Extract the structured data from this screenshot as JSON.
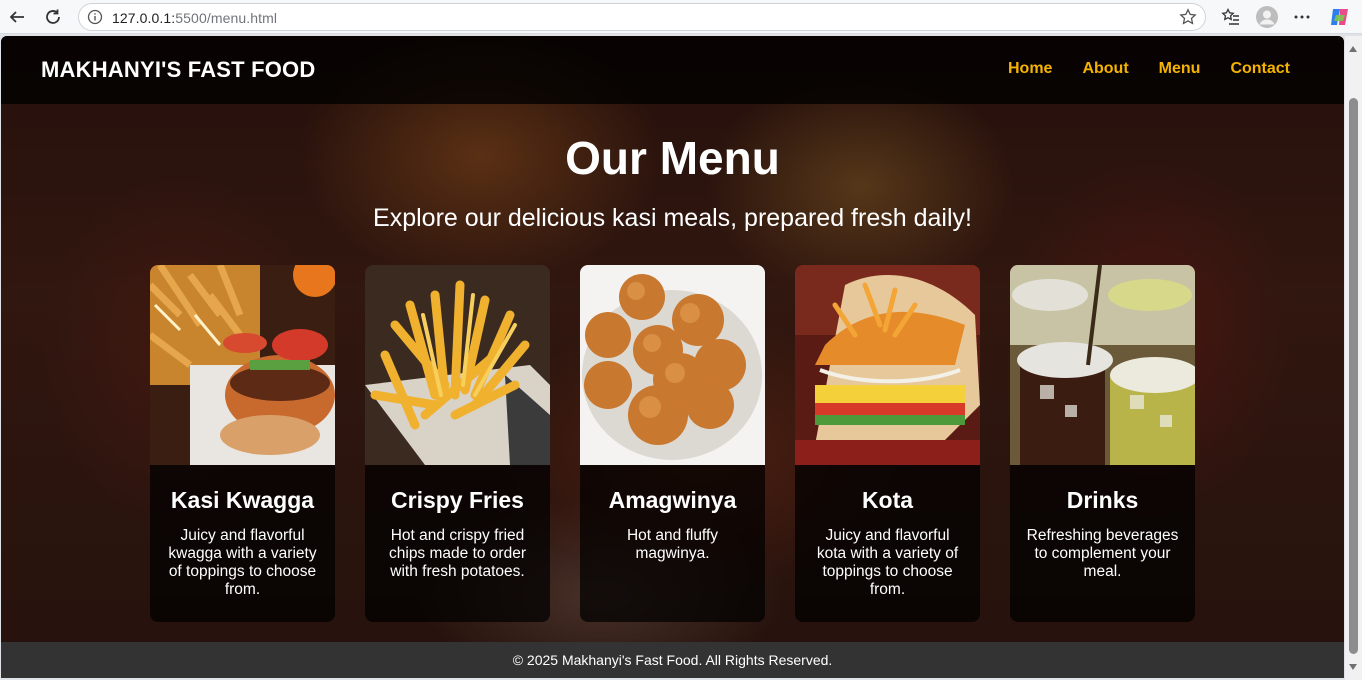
{
  "browser": {
    "url_host": "127.0.0.1:",
    "url_rest": "5500/menu.html"
  },
  "site": {
    "logo": "MAKHANYI'S FAST FOOD",
    "nav": [
      "Home",
      "About",
      "Menu",
      "Contact"
    ],
    "accent_color": "#f5b301"
  },
  "hero": {
    "title": "Our Menu",
    "subtitle": "Explore our delicious kasi meals, prepared fresh daily!"
  },
  "menu_items": [
    {
      "name": "Kasi Kwagga",
      "description": "Juicy and flavorful kwagga with a variety of toppings to choose from.",
      "image": "burger-and-chips-photo"
    },
    {
      "name": "Crispy Fries",
      "description": "Hot and crispy fried chips made to order with fresh potatoes.",
      "image": "fries-basket-photo"
    },
    {
      "name": "Amagwinya",
      "description": "Hot and fluffy magwinya.",
      "image": "vetkoek-bowl-photo"
    },
    {
      "name": "Kota",
      "description": "Juicy and flavorful kota with a variety of toppings to choose from.",
      "image": "kota-sandwich-photo"
    },
    {
      "name": "Drinks",
      "description": "Refreshing beverages to complement your meal.",
      "image": "iced-drinks-photo"
    }
  ],
  "footer": {
    "text": "© 2025 Makhanyi's Fast Food. All Rights Reserved."
  }
}
